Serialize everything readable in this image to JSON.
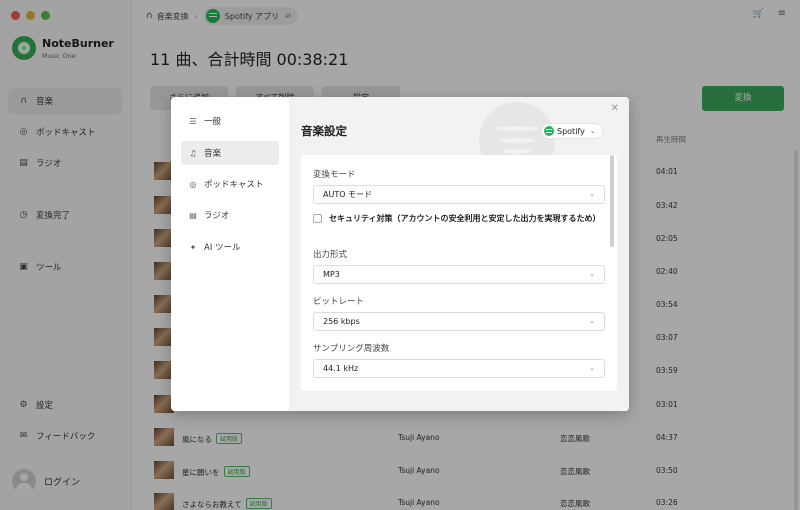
{
  "app": {
    "brand_name": "NoteBurner",
    "brand_sub": "Music One"
  },
  "sidebar": {
    "items": [
      {
        "label": "音楽",
        "icon": "headphones-icon",
        "active": true
      },
      {
        "label": "ポッドキャスト",
        "icon": "podcast-icon"
      },
      {
        "label": "ラジオ",
        "icon": "radio-icon"
      },
      {
        "label": "変換完了",
        "icon": "history-icon"
      },
      {
        "label": "ツール",
        "icon": "toolbox-icon"
      },
      {
        "label": "設定",
        "icon": "gear-icon"
      },
      {
        "label": "フィードバック",
        "icon": "mail-icon"
      }
    ],
    "login_label": "ログイン"
  },
  "header": {
    "breadcrumb_root": "音楽変換",
    "source_label": "Spotify アプリ"
  },
  "main": {
    "title": "11 曲、合計時間 00:38:21",
    "toolbar": [
      "さらに追加",
      "すべて削除",
      "設定"
    ],
    "convert_label": "変換",
    "time_column": "再生時間",
    "badge_label": "試用版",
    "tracks": [
      {
        "title": "",
        "artist": "",
        "album": "",
        "time": "04:01"
      },
      {
        "title": "",
        "artist": "",
        "album": "",
        "time": "03:42"
      },
      {
        "title": "",
        "artist": "",
        "album": "",
        "time": "02:05"
      },
      {
        "title": "",
        "artist": "",
        "album": "",
        "time": "02:40"
      },
      {
        "title": "",
        "artist": "",
        "album": "",
        "time": "03:54"
      },
      {
        "title": "",
        "artist": "",
        "album": "",
        "time": "03:07"
      },
      {
        "title": "",
        "artist": "",
        "album": "",
        "time": "03:59"
      },
      {
        "title": "",
        "artist": "",
        "album": "",
        "time": "03:01"
      },
      {
        "title": "風になる",
        "artist": "Tsuji Ayano",
        "album": "恋恋風歌",
        "time": "04:37"
      },
      {
        "title": "星に願いを",
        "artist": "Tsuji Ayano",
        "album": "恋恋風歌",
        "time": "03:50"
      },
      {
        "title": "さよならお教えて",
        "artist": "Tsuji Ayano",
        "album": "恋恋風歌",
        "time": "03:26"
      }
    ]
  },
  "modal": {
    "nav": [
      {
        "label": "一般",
        "icon": "sliders-icon"
      },
      {
        "label": "音楽",
        "icon": "music-note-icon",
        "active": true
      },
      {
        "label": "ポッドキャスト",
        "icon": "podcast-icon"
      },
      {
        "label": "ラジオ",
        "icon": "radio-icon"
      },
      {
        "label": "AI ツール",
        "icon": "ai-icon"
      }
    ],
    "title": "音楽設定",
    "source": "Spotify",
    "fields": {
      "mode_label": "変換モード",
      "mode_value": "AUTO モード",
      "security_text": "セキュリティ対策（アカウントの安全利用と安定した出力を実現するため）",
      "format_label": "出力形式",
      "format_value": "MP3",
      "bitrate_label": "ビットレート",
      "bitrate_value": "256 kbps",
      "samplerate_label": "サンプリング周波数",
      "samplerate_value": "44.1 kHz"
    }
  },
  "colors": {
    "accent_green": "#3aa55a",
    "spotify_green": "#1db954"
  }
}
